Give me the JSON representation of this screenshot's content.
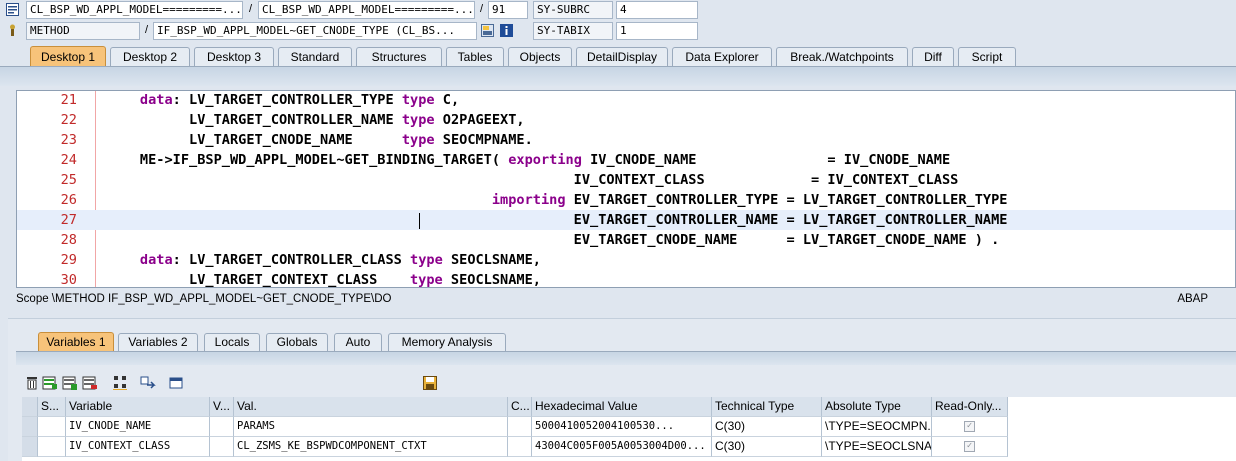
{
  "header": {
    "row1": {
      "program": "CL_BSP_WD_APPL_MODEL=========...",
      "include": "CL_BSP_WD_APPL_MODEL=========...",
      "line": "91",
      "sysvar": "SY-SUBRC",
      "sysval": "4"
    },
    "row2": {
      "event_type": "METHOD",
      "event": "IF_BSP_WD_APPL_MODEL~GET_CNODE_TYPE (CL_BS...",
      "sysvar": "SY-TABIX",
      "sysval": "1"
    }
  },
  "tabs": [
    {
      "label": "Desktop 1",
      "active": true
    },
    {
      "label": "Desktop 2"
    },
    {
      "label": "Desktop 3"
    },
    {
      "label": "Standard"
    },
    {
      "label": "Structures"
    },
    {
      "label": "Tables"
    },
    {
      "label": "Objects"
    },
    {
      "label": "DetailDisplay"
    },
    {
      "label": "Data Explorer"
    },
    {
      "label": "Break./Watchpoints"
    },
    {
      "label": "Diff"
    },
    {
      "label": "Script"
    }
  ],
  "code": {
    "lines": [
      {
        "num": "21",
        "parts": [
          [
            "",
            "     "
          ],
          [
            "kw",
            "data"
          ],
          [
            "",
            ": LV_TARGET_CONTROLLER_TYPE "
          ],
          [
            "kw",
            "type"
          ],
          [
            "",
            " C,"
          ]
        ]
      },
      {
        "num": "22",
        "parts": [
          [
            "",
            "           LV_TARGET_CONTROLLER_NAME "
          ],
          [
            "kw",
            "type"
          ],
          [
            "",
            " O2PAGEEXT,"
          ]
        ]
      },
      {
        "num": "23",
        "parts": [
          [
            "",
            "           LV_TARGET_CNODE_NAME      "
          ],
          [
            "kw",
            "type"
          ],
          [
            "",
            " SEOCMPNAME."
          ]
        ]
      },
      {
        "num": "24",
        "parts": [
          [
            "",
            "     ME->IF_BSP_WD_APPL_MODEL~GET_BINDING_TARGET( "
          ],
          [
            "kw",
            "exporting"
          ],
          [
            "",
            " IV_CNODE_NAME                = IV_CNODE_NAME"
          ]
        ]
      },
      {
        "num": "25",
        "parts": [
          [
            "",
            "                                                          IV_CONTEXT_CLASS             = IV_CONTEXT_CLASS"
          ]
        ]
      },
      {
        "num": "26",
        "parts": [
          [
            "",
            "                                                "
          ],
          [
            "kw",
            "importing"
          ],
          [
            "",
            " EV_TARGET_CONTROLLER_TYPE = LV_TARGET_CONTROLLER_TYPE"
          ]
        ]
      },
      {
        "num": "27",
        "parts": [
          [
            "",
            "                                                          EV_TARGET_CONTROLLER_NAME = LV_TARGET_CONTROLLER_NAME"
          ]
        ],
        "current": true
      },
      {
        "num": "28",
        "parts": [
          [
            "",
            "                                                          EV_TARGET_CNODE_NAME      = LV_TARGET_CNODE_NAME ) ."
          ]
        ]
      },
      {
        "num": "29",
        "parts": [
          [
            "",
            "     "
          ],
          [
            "kw",
            "data"
          ],
          [
            "",
            ": LV_TARGET_CONTROLLER_CLASS "
          ],
          [
            "kw",
            "type"
          ],
          [
            "",
            " SEOCLSNAME,"
          ]
        ]
      },
      {
        "num": "30",
        "parts": [
          [
            "",
            "           LV_TARGET_CONTEXT_CLASS    "
          ],
          [
            "kw",
            "type"
          ],
          [
            "",
            " SEOCLSNAME,"
          ]
        ]
      }
    ]
  },
  "scope": {
    "text": "Scope \\METHOD IF_BSP_WD_APPL_MODEL~GET_CNODE_TYPE\\DO",
    "language": "ABAP"
  },
  "bottom_tabs": [
    {
      "label": "Variables 1",
      "active": true
    },
    {
      "label": "Variables 2"
    },
    {
      "label": "Locals"
    },
    {
      "label": "Globals"
    },
    {
      "label": "Auto"
    },
    {
      "label": "Memory Analysis"
    }
  ],
  "grid": {
    "headers": [
      "S...",
      "Variable",
      "V...",
      "Val.",
      "C...",
      "Hexadecimal Value",
      "Technical Type",
      "Absolute Type",
      "Read-Only..."
    ],
    "rows": [
      [
        "",
        "IV_CNODE_NAME",
        "",
        "PARAMS",
        "",
        "5000410052004100530...",
        "C(30)",
        "\\TYPE=SEOCMPN...",
        "✓"
      ],
      [
        "",
        "IV_CONTEXT_CLASS",
        "",
        "CL_ZSMS_KE_BSPWDCOMPONENT_CTXT",
        "",
        "43004C005F005A0053004D00...",
        "C(30)",
        "\\TYPE=SEOCLSNA...",
        "✓"
      ]
    ]
  },
  "colors": {
    "active_tab": "#f7c37a",
    "keyword": "#8b008b",
    "line_number": "#c12a2a"
  }
}
